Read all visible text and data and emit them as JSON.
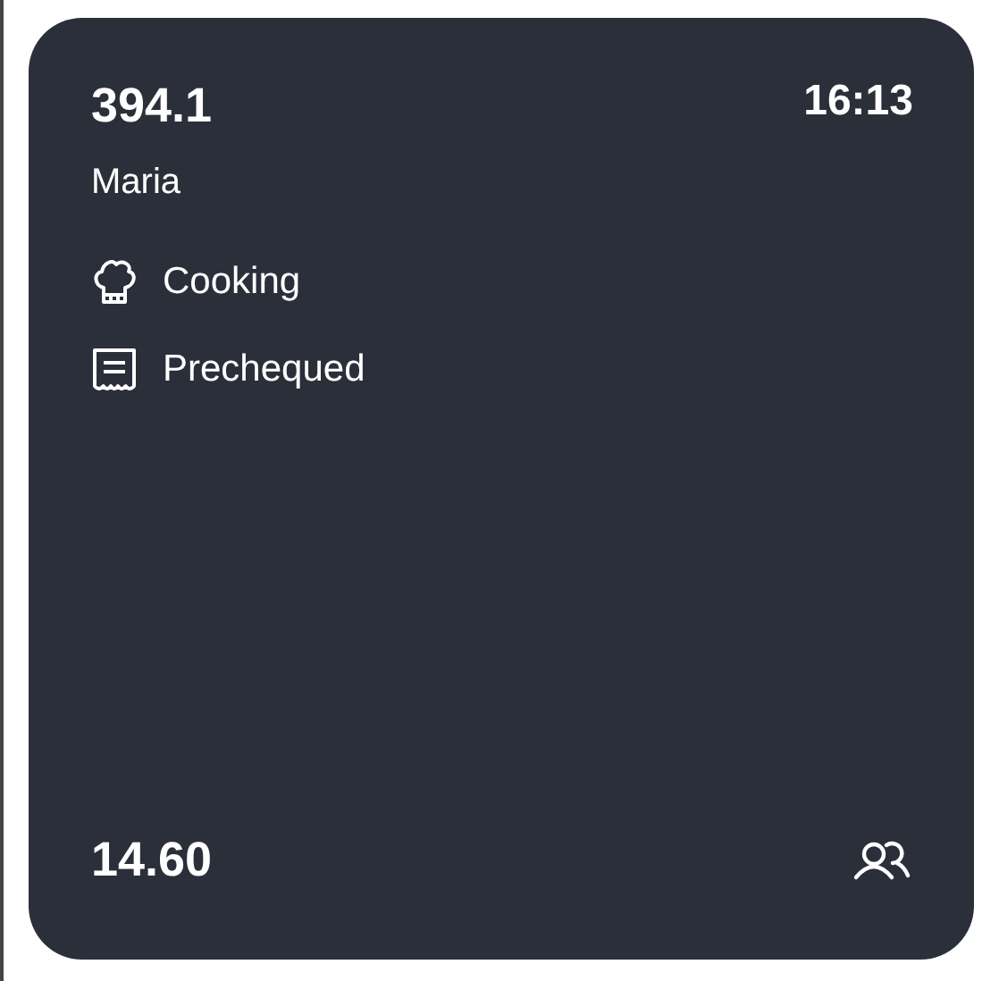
{
  "order": {
    "number": "394.1",
    "time": "16:13",
    "waiter": "Maria",
    "statuses": [
      {
        "kind": "cooking",
        "label": "Cooking"
      },
      {
        "kind": "receipt",
        "label": "Prechequed"
      }
    ],
    "total": "14.60"
  }
}
